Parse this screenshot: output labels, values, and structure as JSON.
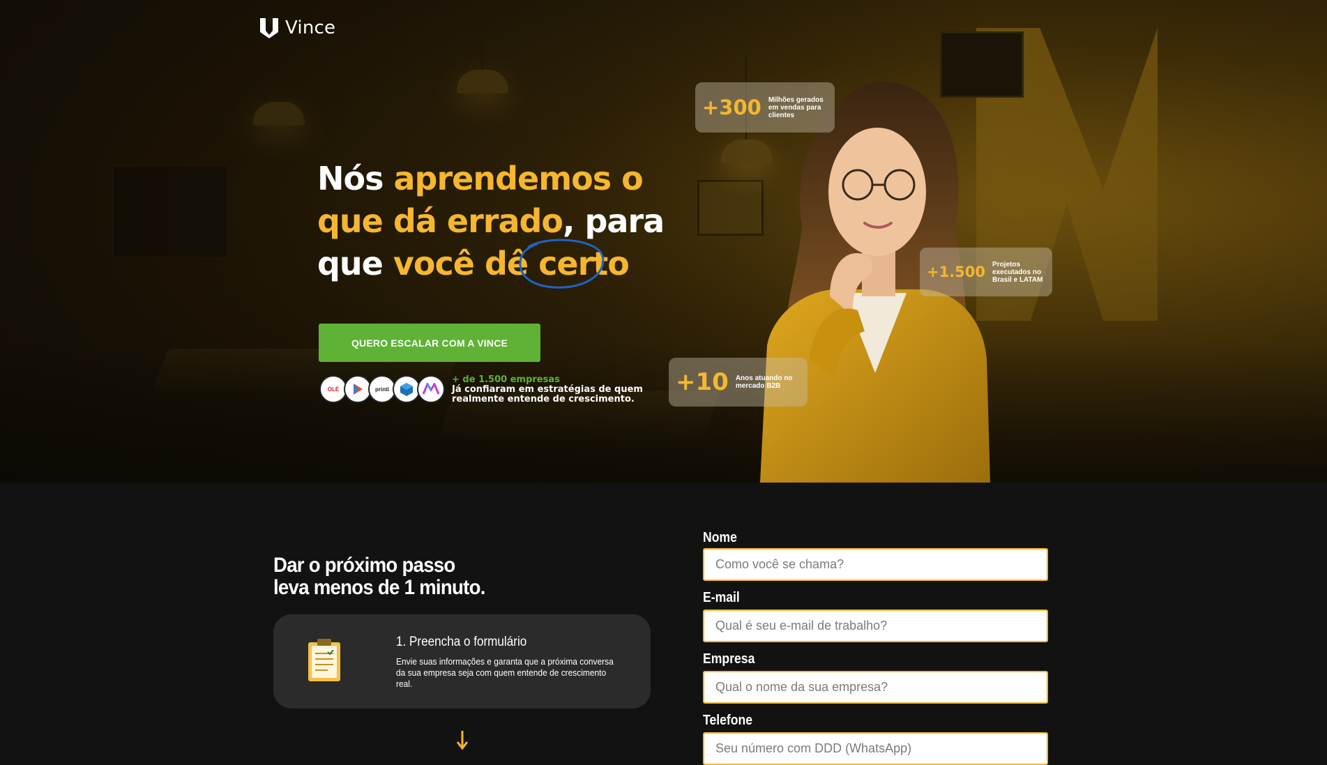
{
  "brand": {
    "name": "Vince"
  },
  "hero": {
    "headline": {
      "w1": "Nós",
      "w2": "aprendemos o",
      "w3": "que dá errado",
      "w4": ", para",
      "w5": "que",
      "w6": "você dê",
      "w7": "certo"
    },
    "cta_label": "QUERO ESCALAR COM A VINCE",
    "clients": [
      "OLÉ",
      "",
      "printi",
      "",
      ""
    ],
    "trust_count": "+ de 1.500 empresas",
    "trust_text": "Já confiaram em estratégias de quem realmente entende de crescimento.",
    "stats": [
      {
        "number": "+300",
        "label": "Milhões gerados em vendas para clientes"
      },
      {
        "number": "+1.500",
        "label": "Projetos executados no Brasil e LATAM"
      },
      {
        "number": "+10",
        "label": "Anos atuando no mercado B2B"
      }
    ]
  },
  "steps": {
    "title_line1": "Dar o próximo passo",
    "title_line2": "leva menos de 1 minuto.",
    "step1_title": "1. Preencha o formulário",
    "step1_text": "Envie suas informações e garanta que a próxima conversa da sua empresa seja com quem entende de crescimento real."
  },
  "form": {
    "name_label": "Nome",
    "name_placeholder": "Como você se chama?",
    "email_label": "E-mail",
    "email_placeholder": "Qual é seu e-mail de trabalho?",
    "company_label": "Empresa",
    "company_placeholder": "Qual o nome da sua empresa?",
    "phone_label": "Telefone",
    "phone_placeholder": "Seu número com DDD (WhatsApp)"
  },
  "colors": {
    "accent": "#f5b72f",
    "cta": "#5fb236",
    "dark": "#121212",
    "card": "#2b2b2b"
  }
}
